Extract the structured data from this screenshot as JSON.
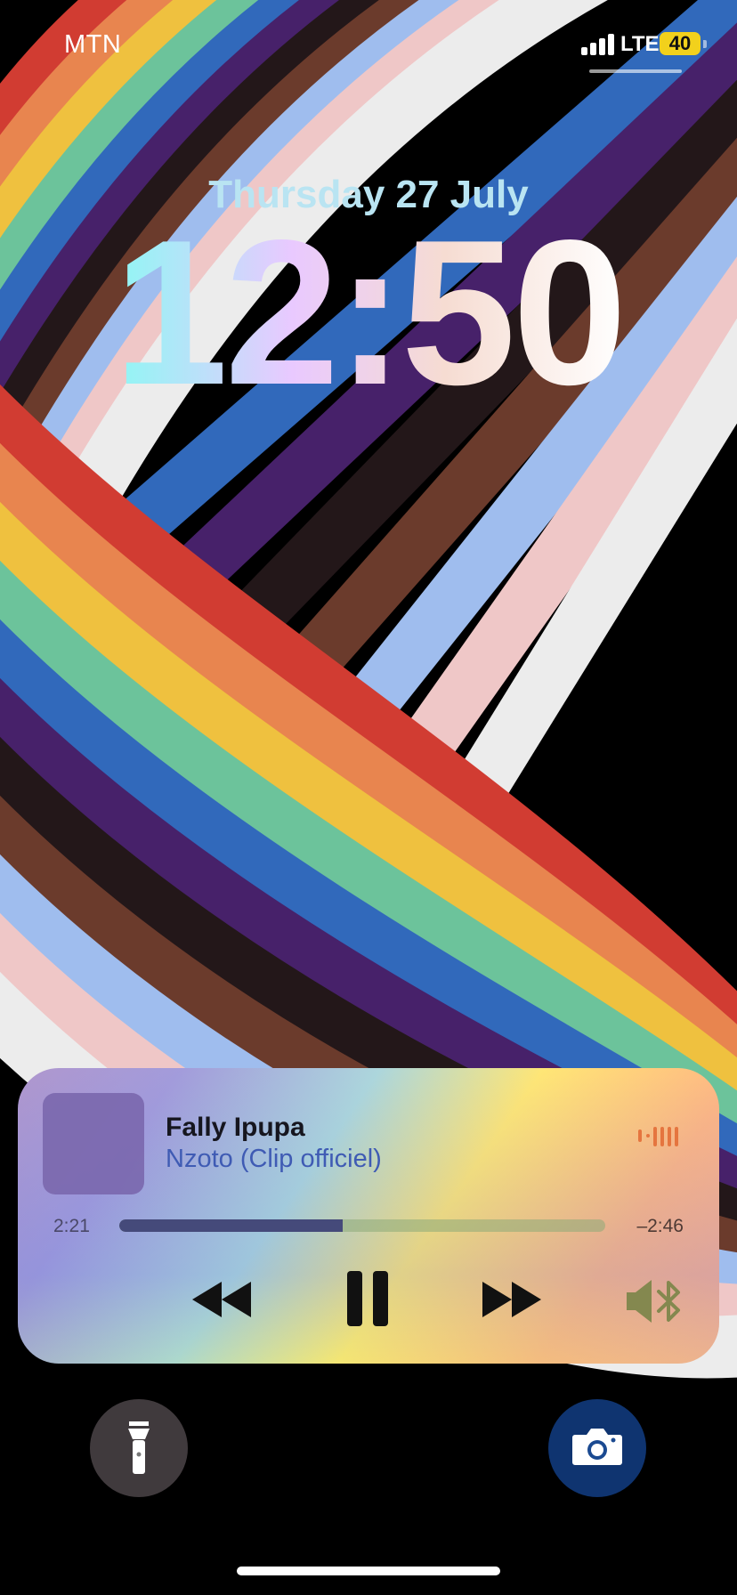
{
  "status_bar": {
    "carrier": "MTN",
    "network": "LTE",
    "battery": "40",
    "signal_bars": 4,
    "battery_color": "#f2d11c"
  },
  "lock": {
    "date": "Thursday 27 July",
    "time": "12:50"
  },
  "player": {
    "artist": "Fally Ipupa",
    "track": "Nzoto (Clip officiel)",
    "elapsed": "2:21",
    "remaining": "–2:46",
    "progress_fraction": 0.46,
    "controls": [
      "rewind-icon",
      "pause-icon",
      "fast-forward-icon",
      "bluetooth-speaker-icon"
    ],
    "accent_color": "#e5753f"
  },
  "quick_actions": [
    "flashlight-icon",
    "camera-icon"
  ],
  "wallpaper": {
    "stripe_colors": [
      "#d13c32",
      "#e8854f",
      "#efc13f",
      "#6cc39b",
      "#3169bb",
      "#47216a",
      "#231719",
      "#6b3b2c",
      "#9fbdee",
      "#efc7c7",
      "#ececec"
    ]
  }
}
